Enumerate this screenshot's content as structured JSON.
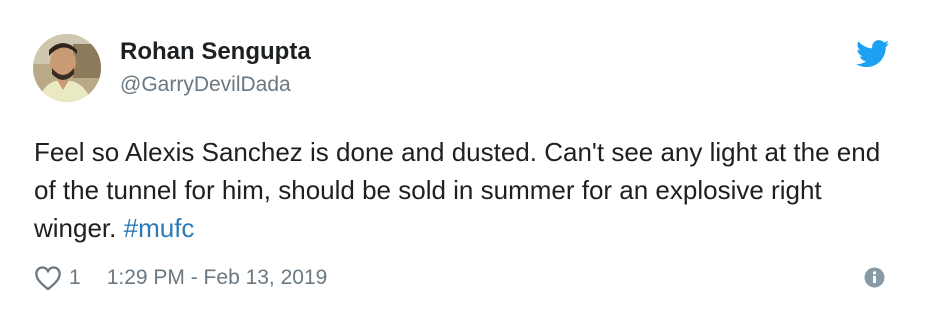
{
  "author": {
    "name": "Rohan Sengupta",
    "handle": "@GarryDevilDada"
  },
  "tweet": {
    "text": "Feel so Alexis Sanchez is done and dusted. Can't see any light at the end of the tunnel for him, should be sold in summer for an explosive right winger. ",
    "hashtag": "#mufc"
  },
  "footer": {
    "like_count": "1",
    "timestamp": "1:29 PM - Feb 13, 2019"
  },
  "icons": {
    "brand": "twitter-bird-icon",
    "like": "heart-icon",
    "info": "info-icon"
  },
  "colors": {
    "brand": "#1da1f2",
    "hashtag": "#2b7bb9",
    "secondary_text": "#697882",
    "primary_text": "#1c2022"
  }
}
